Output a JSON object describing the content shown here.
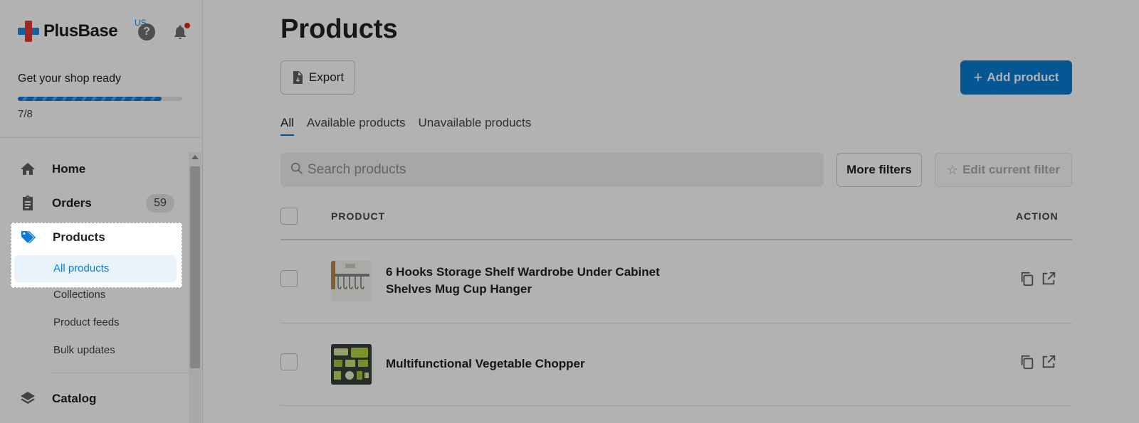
{
  "brand": {
    "name": "PlusBase",
    "region": "US"
  },
  "setup": {
    "title": "Get your shop ready",
    "progress_text": "7/8",
    "progress_fraction": 0.875
  },
  "nav": {
    "home": "Home",
    "orders": "Orders",
    "orders_count": "59",
    "products": "Products",
    "sub_items": {
      "all_products": "All products",
      "collections": "Collections",
      "product_feeds": "Product feeds",
      "bulk_updates": "Bulk updates"
    },
    "catalog": "Catalog"
  },
  "page": {
    "title": "Products",
    "export_label": "Export",
    "add_label": "Add product",
    "tabs": [
      "All",
      "Available products",
      "Unavailable products"
    ],
    "search_placeholder": "Search products",
    "more_filters": "More filters",
    "edit_filter": "Edit current filter"
  },
  "table": {
    "headers": {
      "product": "PRODUCT",
      "action": "ACTION"
    },
    "rows": [
      {
        "title": "6 Hooks Storage Shelf Wardrobe Under Cabinet Shelves Mug Cup Hanger"
      },
      {
        "title": "Multifunctional Vegetable Chopper"
      }
    ]
  },
  "colors": {
    "accent": "#0b7bd4",
    "overlay": "rgba(0,0,0,0.3)"
  }
}
